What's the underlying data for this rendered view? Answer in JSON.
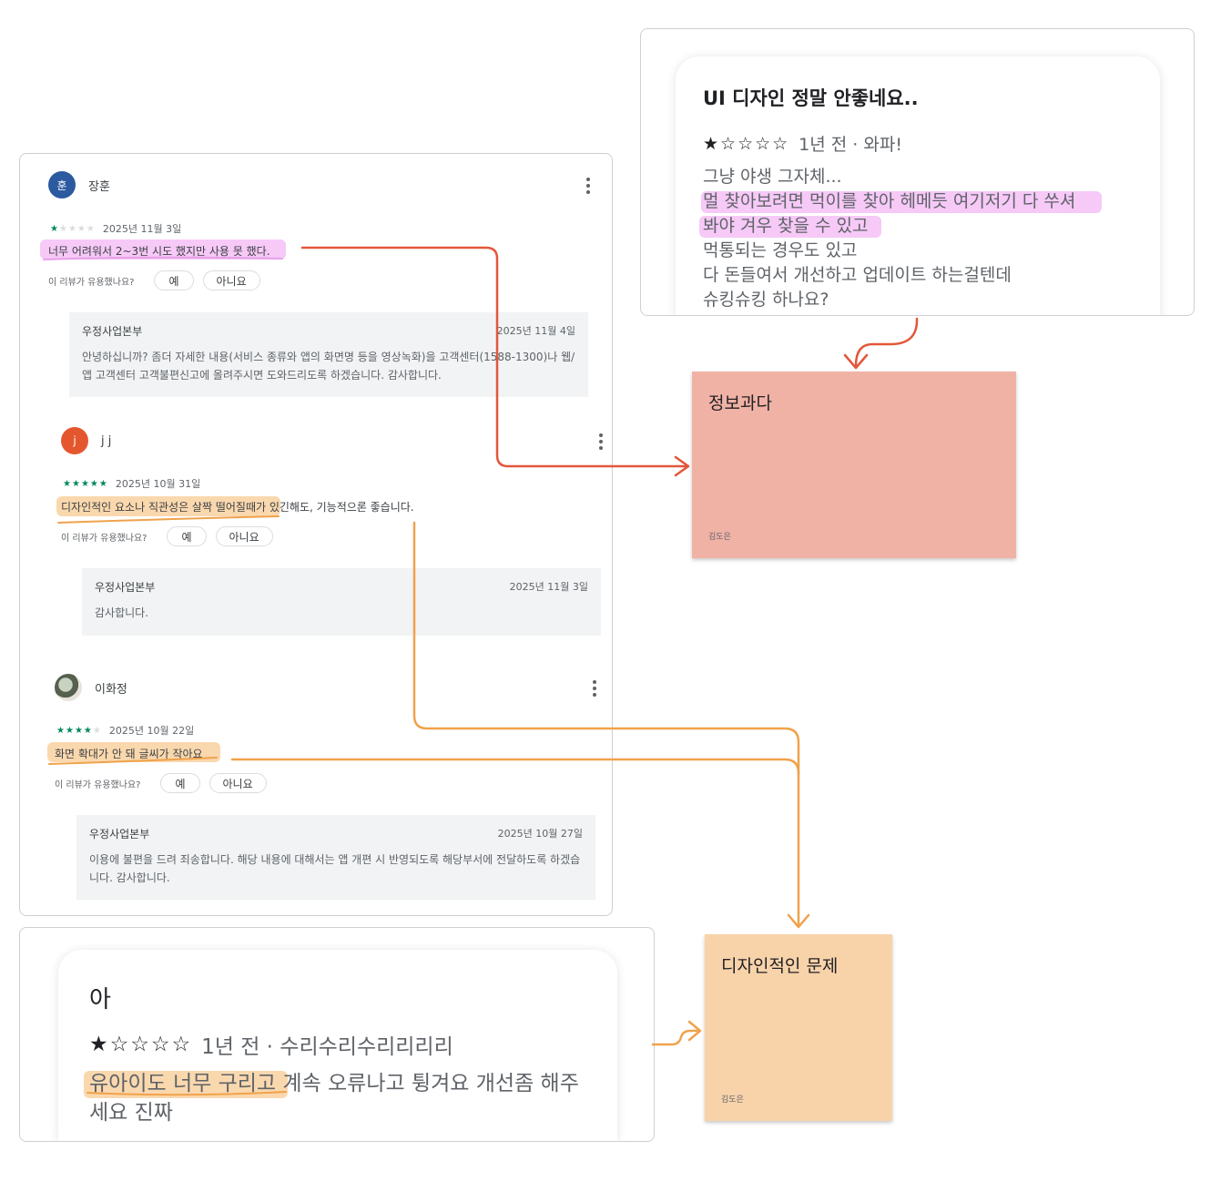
{
  "colors": {
    "pink_highlight": "#ee9cf0",
    "orange_highlight": "#f6b86b",
    "red_connector": "#e2573a",
    "orange_connector": "#f0a24c",
    "sticky_info": "#f1b2a6",
    "sticky_design": "#f8d3aa",
    "star_green": "#01875f"
  },
  "reviews": [
    {
      "author": "장훈",
      "avatar_letter": "훈",
      "avatar_color": "#2c5aa0",
      "rating": 1,
      "date": "2025년 11월 3일",
      "text": "너무 어려워서 2~3번 시도 했지만 사용 못 했다.",
      "helpful_prompt": "이 리뷰가 유용했나요?",
      "yes": "예",
      "no": "아니요",
      "reply": {
        "author": "우정사업본부",
        "date": "2025년 11월 4일",
        "text": "안녕하십니까? 좀더 자세한 내용(서비스 종류와 앱의 화면명 등을 영상녹화)을 고객센터(1588-1300)나 웹/앱 고객센터 고객불편신고에 올려주시면 도와드리도록 하겠습니다. 감사합니다."
      }
    },
    {
      "author": "j j",
      "avatar_letter": "j",
      "avatar_color": "#e4572e",
      "rating": 5,
      "date": "2025년 10월 31일",
      "text": "디자인적인 요소나 직관성은 살짝 떨어질때가 있긴해도, 기능적으론 좋습니다.",
      "helpful_prompt": "이 리뷰가 유용했나요?",
      "yes": "예",
      "no": "아니요",
      "reply": {
        "author": "우정사업본부",
        "date": "2025년 11월 3일",
        "text": "감사합니다."
      }
    },
    {
      "author": "이화정",
      "rating": 4,
      "date": "2025년 10월 22일",
      "text": "화면 확대가 안 돼 글씨가 작아요",
      "helpful_prompt": "이 리뷰가 유용했나요?",
      "yes": "예",
      "no": "아니요",
      "reply": {
        "author": "우정사업본부",
        "date": "2025년 10월 27일",
        "text": "이용에 불편을 드려 죄송합니다. 해당 내용에 대해서는 앱 개편 시 반영되도록 해당부서에 전달하도록 하겠습니다. 감사합니다."
      }
    }
  ],
  "top_card": {
    "title": "UI 디자인 정말 안좋네요..",
    "stars": "★☆☆☆☆",
    "meta": "1년 전 · 와파!",
    "lines": [
      "그냥 야생 그자체...",
      "멀 찾아보려면 먹이를 찾아 헤메듯 여기저기 다 쑤셔",
      "봐야 겨우 찾을 수 있고",
      "먹통되는 경우도 있고",
      "다 돈들여서 개선하고 업데이트 하는걸텐데",
      "슈킹슈킹 하나요?"
    ]
  },
  "bottom_card": {
    "title": "아",
    "stars": "★☆☆☆☆",
    "meta": "1년 전 · 수리수리수리리리리",
    "text": "유아이도 너무 구리고 계속 오류나고 튕겨요 개선좀 해주세요 진짜"
  },
  "stickies": [
    {
      "title": "정보과다",
      "author": "김도은"
    },
    {
      "title": "디자인적인 문제",
      "author": "김도은"
    }
  ]
}
